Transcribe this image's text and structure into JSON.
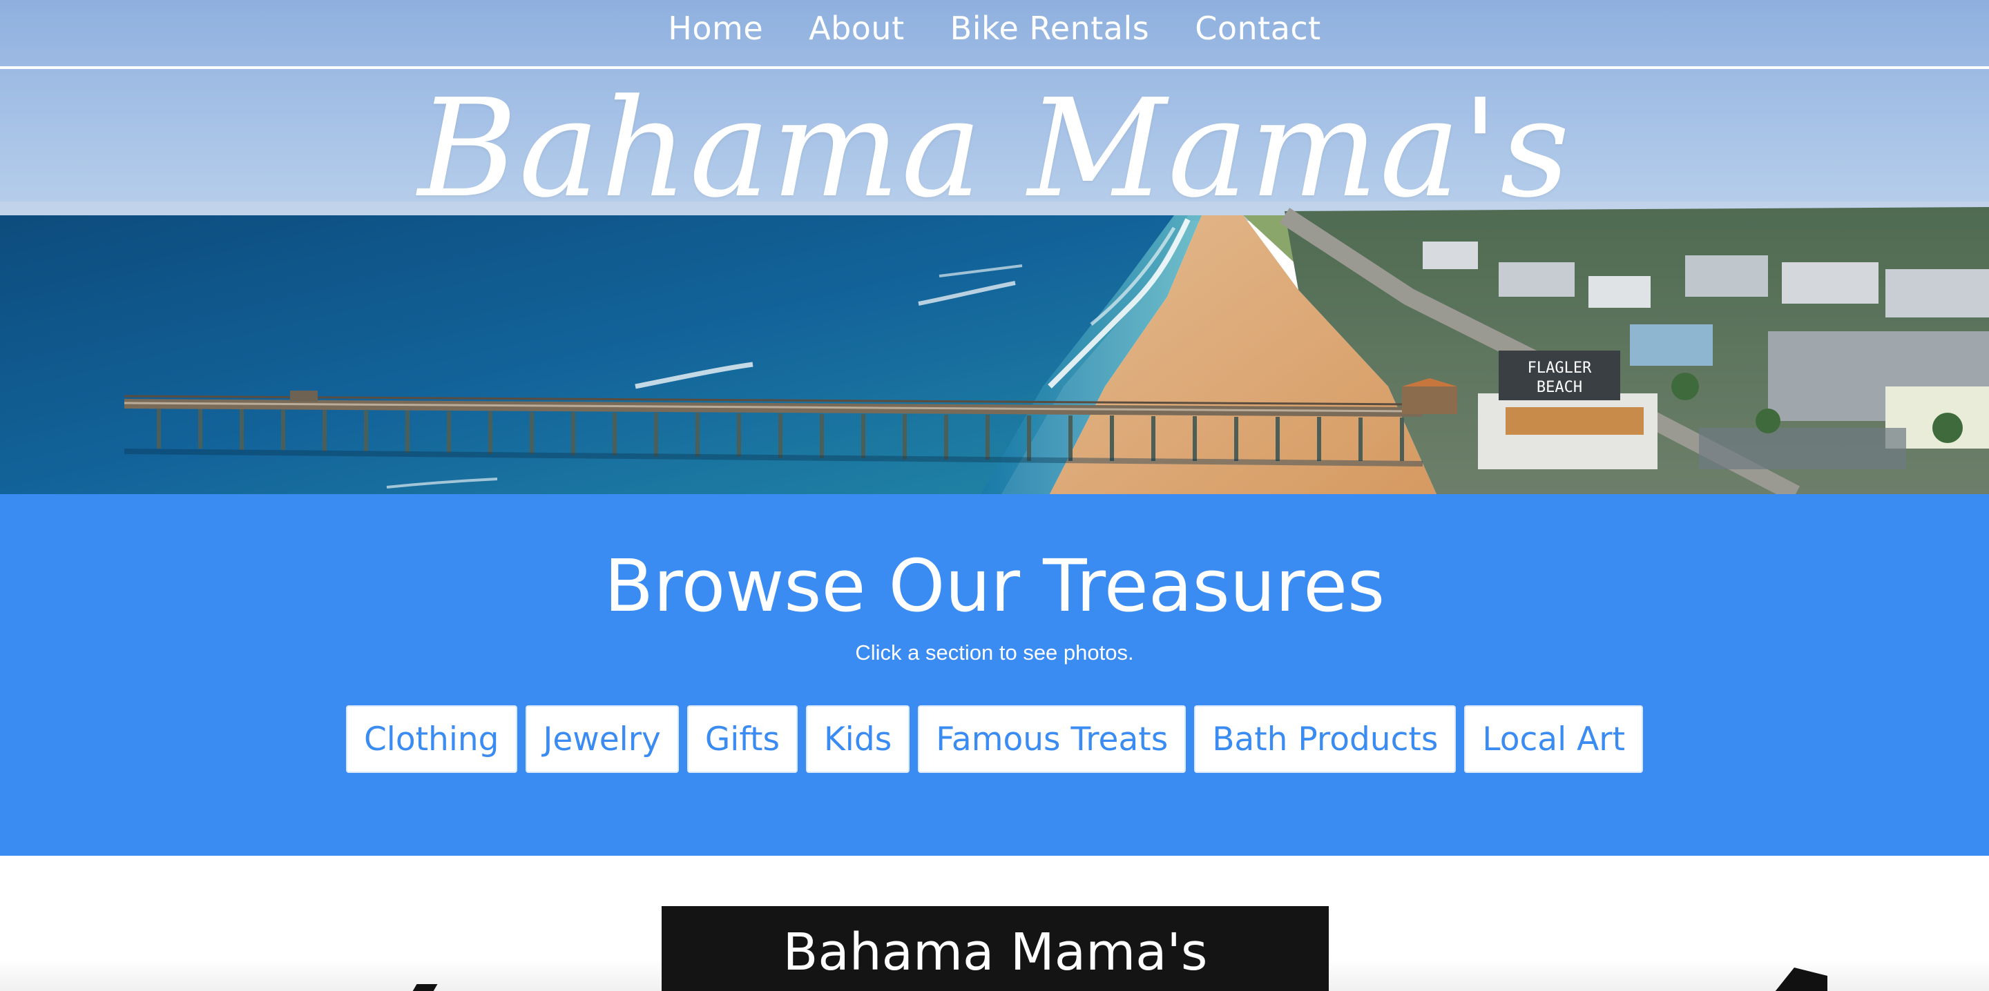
{
  "nav": {
    "items": [
      {
        "label": "Home"
      },
      {
        "label": "About"
      },
      {
        "label": "Bike Rentals"
      },
      {
        "label": "Contact"
      }
    ]
  },
  "hero": {
    "brand": "Bahama Mama's",
    "sign_text": "FLAGLER BEACH"
  },
  "browse": {
    "title": "Browse Our Treasures",
    "subtitle": "Click a section to see photos.",
    "categories": [
      {
        "label": "Clothing"
      },
      {
        "label": "Jewelry"
      },
      {
        "label": "Gifts"
      },
      {
        "label": "Kids"
      },
      {
        "label": "Famous Treats"
      },
      {
        "label": "Bath Products"
      },
      {
        "label": "Local Art"
      }
    ]
  },
  "lower": {
    "banner_text": "Bahama Mama's"
  },
  "colors": {
    "accent_blue": "#3a8bf2",
    "white": "#ffffff",
    "banner_dark": "#141414"
  }
}
